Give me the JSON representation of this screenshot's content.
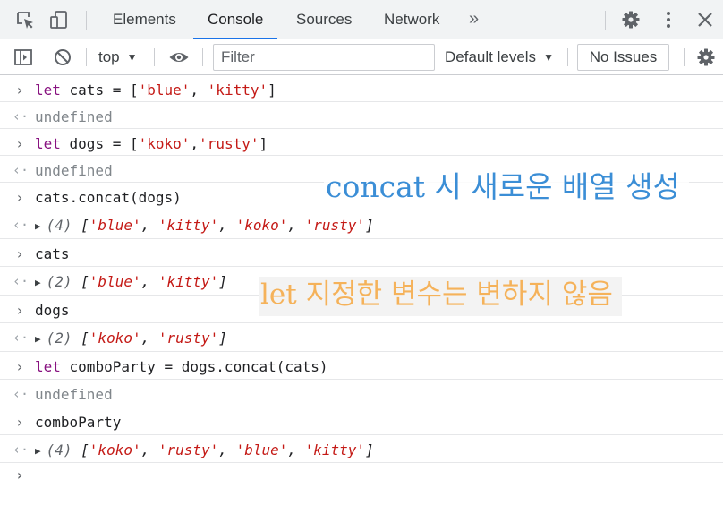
{
  "tabs": {
    "elements": "Elements",
    "console": "Console",
    "sources": "Sources",
    "network": "Network",
    "more": "»"
  },
  "toolbar": {
    "context": "top",
    "filter_placeholder": "Filter",
    "levels": "Default levels",
    "issues": "No Issues"
  },
  "console": {
    "rows": [
      {
        "kind": "input",
        "parts": [
          "let",
          " cats = [",
          "'blue'",
          ", ",
          "'kitty'",
          "]"
        ]
      },
      {
        "kind": "return",
        "text": "undefined"
      },
      {
        "kind": "input",
        "parts": [
          "let",
          " dogs = [",
          "'koko'",
          ",",
          "'rusty'",
          "]"
        ]
      },
      {
        "kind": "return",
        "text": "undefined"
      },
      {
        "kind": "input",
        "text": "cats.concat(dogs)"
      },
      {
        "kind": "result",
        "count": "(4)",
        "values": [
          "'blue'",
          "'kitty'",
          "'koko'",
          "'rusty'"
        ]
      },
      {
        "kind": "input",
        "text": "cats"
      },
      {
        "kind": "result",
        "count": "(2)",
        "values": [
          "'blue'",
          "'kitty'"
        ]
      },
      {
        "kind": "input",
        "text": "dogs"
      },
      {
        "kind": "result",
        "count": "(2)",
        "values": [
          "'koko'",
          "'rusty'"
        ]
      },
      {
        "kind": "input",
        "parts": [
          "let",
          " comboParty = dogs.concat(cats)"
        ]
      },
      {
        "kind": "return",
        "text": "undefined"
      },
      {
        "kind": "input",
        "text": "comboParty"
      },
      {
        "kind": "result",
        "count": "(4)",
        "values": [
          "'koko'",
          "'rusty'",
          "'blue'",
          "'kitty'"
        ]
      }
    ]
  },
  "annotations": {
    "concat_note": "concat 시 새로운 배열 생성",
    "let_note": "let 지정한 변수는 변하지 않음"
  },
  "glyphs": {
    "input_chevron": "›",
    "return_arrow": "‹·",
    "expand": "▶",
    "dropdown": "▼",
    "prompt": "›"
  },
  "colors": {
    "accent": "#1a73e8",
    "keyword": "#881280",
    "string": "#c41a16",
    "concat_note": "#3b8ed6",
    "let_note": "#f5b25a"
  }
}
